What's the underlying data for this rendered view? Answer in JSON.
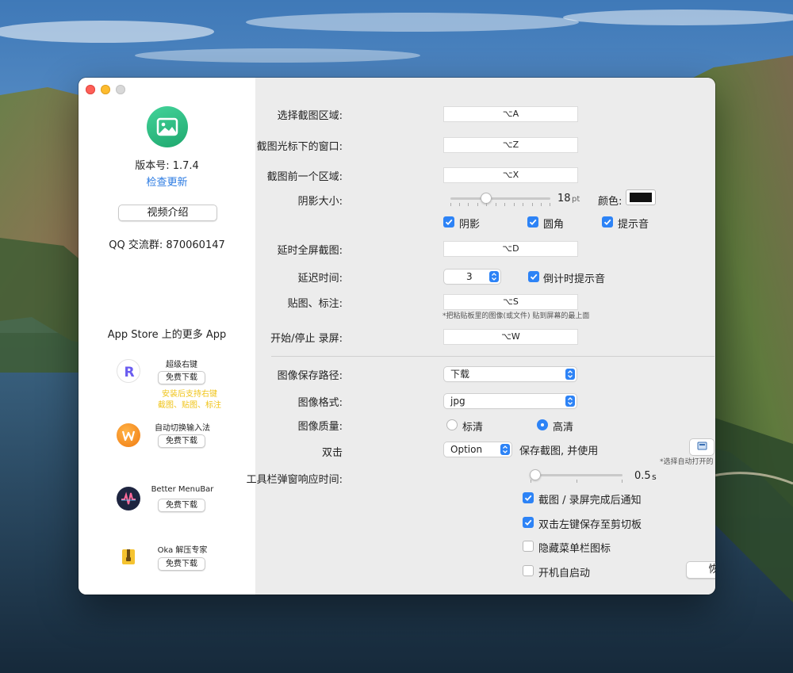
{
  "app": {
    "version_text": "版本号: 1.7.4",
    "check_update": "检查更新",
    "video_intro": "视频介绍",
    "qq_group": "QQ 交流群:  870060147",
    "more_apps_title": "App Store 上的更多 App"
  },
  "promos": [
    {
      "name": "超级右键",
      "button": "免费下载",
      "note_line1": "安装后支持右键",
      "note_line2": "截图、贴图、标注",
      "icon": "super-right-click-icon"
    },
    {
      "name": "自动切换输入法",
      "button": "免费下载",
      "icon": "input-switch-icon"
    },
    {
      "name": "Better MenuBar",
      "button": "免费下载",
      "icon": "better-menubar-icon"
    },
    {
      "name": "Oka 解压专家",
      "button": "免费下载",
      "icon": "oka-unzip-icon"
    }
  ],
  "shortcuts": {
    "select_area_label": "选择截图区域:",
    "select_area_key": "⌥A",
    "cursor_window_label": "截图光标下的窗口:",
    "cursor_window_key": "⌥Z",
    "prev_area_label": "截图前一个区域:",
    "prev_area_key": "⌥X"
  },
  "shadow": {
    "label": "阴影大小:",
    "value": "18",
    "unit": "pt",
    "color_label": "颜色:",
    "level_fraction": 0.36
  },
  "options": {
    "shadow": "阴影",
    "rounded": "圆角",
    "sound": "提示音"
  },
  "delay": {
    "fullscreen_label": "延时全屏截图:",
    "fullscreen_key": "⌥D",
    "time_label": "延迟时间:",
    "time_value": "3",
    "countdown_sound": "倒计时提示音"
  },
  "pin": {
    "label": "贴图、标注:",
    "key": "⌥S",
    "hint": "*把粘贴板里的图像(或文件) 贴到屏幕的最上面"
  },
  "record": {
    "label": "开始/停止 录屏:",
    "key": "⌥W"
  },
  "save": {
    "path_label": "图像保存路径:",
    "path_value": "下载",
    "format_label": "图像格式:",
    "format_value": "jpg",
    "quality_label": "图像质量:",
    "quality_sd": "标清",
    "quality_hd": "高清",
    "dbl_label": "双击",
    "dbl_modifier": "Option",
    "dbl_mid": "保存截图, 并使用",
    "dbl_open": "打开",
    "dbl_hint": "*选择自动打开的 App 名称"
  },
  "toolbar": {
    "label": "工具栏弹窗响应时间:",
    "value": "0.5",
    "unit": "s",
    "level_fraction": 0.0
  },
  "checks": {
    "notify": "截图 / 录屏完成后通知",
    "dblclick_copy": "双击左键保存至剪切板",
    "hide_menubar": "隐藏菜单栏图标",
    "autostart": "开机自启动"
  },
  "restore_defaults": "恢复默认",
  "colors": {
    "accent": "#2d83f6",
    "link": "#2a7ae2",
    "promo_note": "#f0c419"
  }
}
